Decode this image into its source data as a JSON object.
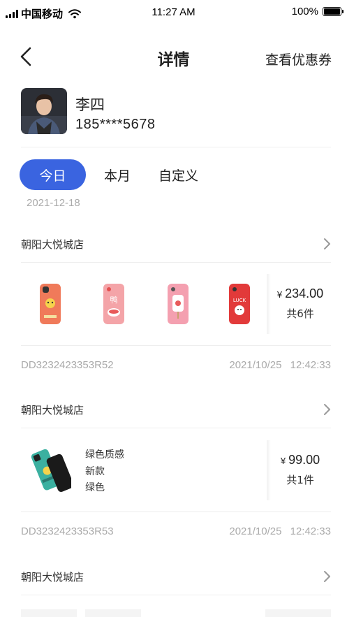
{
  "status": {
    "carrier": "中国移动",
    "time": "11:27 AM",
    "battery_label": "100%",
    "battery_level": 1.0
  },
  "nav": {
    "title": "详情",
    "right_link": "查看优惠券"
  },
  "user": {
    "name": "李四",
    "phone": "185****5678"
  },
  "tabs": [
    {
      "label": "今日"
    },
    {
      "label": "本月"
    },
    {
      "label": "自定义"
    }
  ],
  "date": "2021-12-18",
  "orders": [
    {
      "store": "朝阳大悦城店",
      "price": "234.00",
      "currency": "¥",
      "count_label": "共6件",
      "order_id": "DD3232423353R52",
      "time": "2021/10/25 12:42:33"
    },
    {
      "store": "朝阳大悦城店",
      "price": "99.00",
      "currency": "¥",
      "count_label": "共1件",
      "attrs": [
        "绿色质感",
        "新款",
        "绿色"
      ],
      "order_id": "DD3232423353R53",
      "time": "2021/10/25 12:42:33"
    },
    {
      "store": "朝阳大悦城店"
    }
  ],
  "colors": {
    "accent": "#3a64e0",
    "muted": "#aaaaaa"
  },
  "icons": {
    "back": "chevron-left",
    "row_arrow": "chevron-right"
  }
}
